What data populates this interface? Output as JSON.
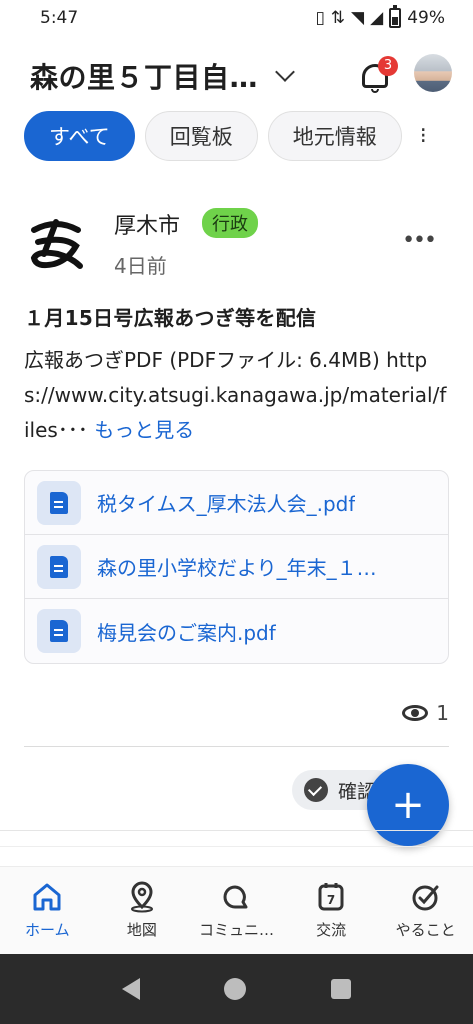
{
  "status": {
    "time": "5:47",
    "battery": "49%"
  },
  "header": {
    "title": "森の里５丁目自…",
    "notification_count": "3"
  },
  "tabs": [
    {
      "label": "すべて",
      "active": true
    },
    {
      "label": "回覧板",
      "active": false
    },
    {
      "label": "地元情報",
      "active": false
    }
  ],
  "post": {
    "org": "厚木市",
    "tag": "行政",
    "time": "4日前",
    "title": "１月15日号広報あつぎ等を配信",
    "body": "広報あつぎPDF (PDFファイル: 6.4MB) https://www.city.atsugi.kanagawa.jp/material/files･･･",
    "more_label": "もっと見る",
    "files": [
      {
        "name": "税タイムス_厚木法人会_.pdf"
      },
      {
        "name": "森の里小学校だより_年末_１…"
      },
      {
        "name": "梅見会のご案内.pdf"
      }
    ],
    "views": "1",
    "confirm_label": "確認"
  },
  "fab": {
    "label": "+"
  },
  "bottom_nav": [
    {
      "label": "ホーム",
      "icon": "home-icon",
      "active": true
    },
    {
      "label": "地図",
      "icon": "map-pin-icon",
      "active": false
    },
    {
      "label": "コミュニ…",
      "icon": "chat-icon",
      "active": false
    },
    {
      "label": "交流",
      "icon": "calendar-icon",
      "active": false
    },
    {
      "label": "やること",
      "icon": "check-circle-icon",
      "active": false
    }
  ],
  "calendar_day": "7",
  "colors": {
    "accent": "#1a66d2",
    "badge": "#e53935",
    "tag": "#6fd24a"
  }
}
